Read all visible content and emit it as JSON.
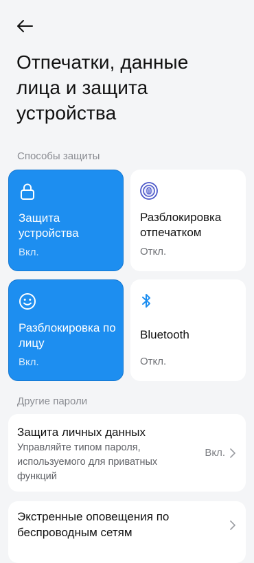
{
  "header": {
    "back_icon": "arrow-left-icon",
    "title": "Отпечатки, данные лица и защита устройства"
  },
  "sections": {
    "protection_methods": "Способы защиты",
    "other_passwords": "Другие пароли"
  },
  "tiles": [
    {
      "id": "device-protection",
      "icon": "lock-icon",
      "label": "Защита устройства",
      "status": "Вкл.",
      "active": true
    },
    {
      "id": "fingerprint-unlock",
      "icon": "fingerprint-icon",
      "label": "Разблокировка отпечатком",
      "status": "Откл.",
      "active": false
    },
    {
      "id": "face-unlock",
      "icon": "smiley-face-icon",
      "label": "Разблокировка по лицу",
      "status": "Вкл.",
      "active": true
    },
    {
      "id": "bluetooth",
      "icon": "bluetooth-icon",
      "label": "Bluetooth",
      "status": "Откл.",
      "active": false
    }
  ],
  "list": [
    {
      "title": "Защита личных данных",
      "description": "Управляйте типом пароля, используемого для приватных функций",
      "value": "Вкл."
    },
    {
      "title": "Экстренные оповещения по беспроводным сетям",
      "description": "",
      "value": ""
    }
  ],
  "colors": {
    "accent": "#1d8ef0",
    "background": "#f4f5f7",
    "card": "#ffffff",
    "secondary_text": "#8a8c92"
  }
}
